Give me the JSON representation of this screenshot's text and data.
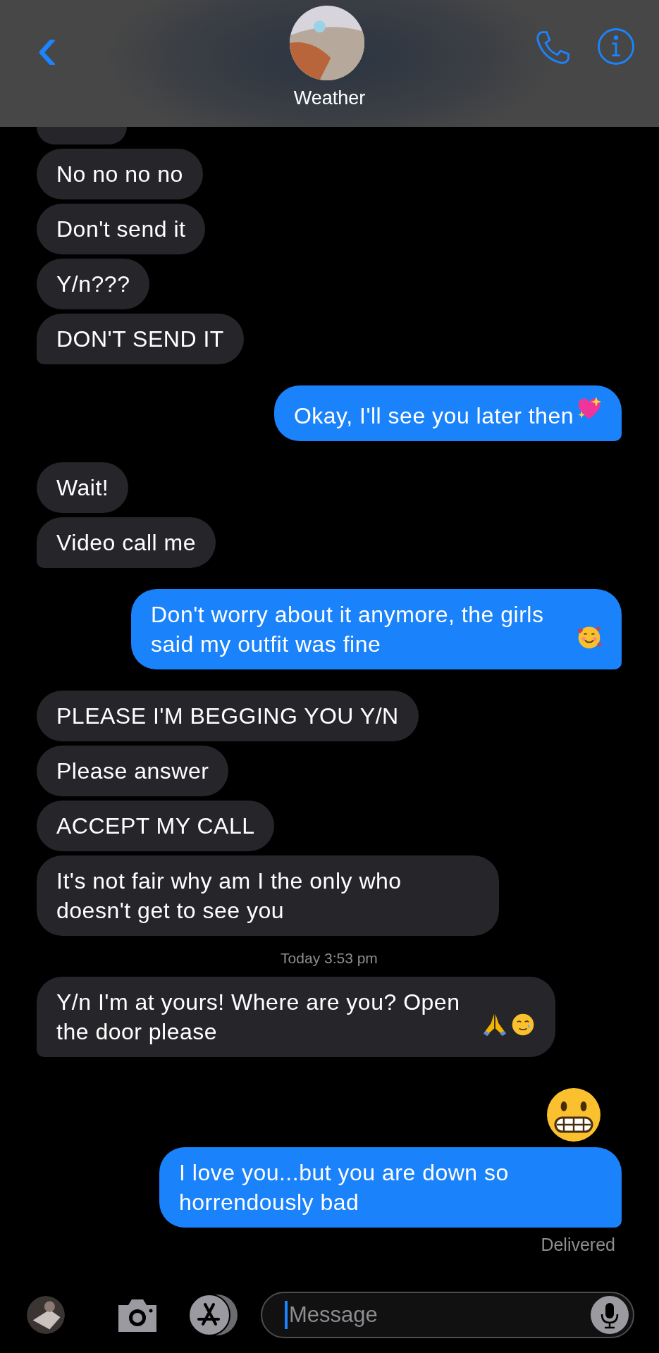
{
  "header": {
    "back": "‹",
    "contact": "Weather"
  },
  "messages": [
    {
      "outgoing": false,
      "kind": "cut"
    },
    {
      "outgoing": false,
      "kind": "text",
      "text": "No no no no"
    },
    {
      "outgoing": false,
      "kind": "text",
      "text": "Don't send it"
    },
    {
      "outgoing": false,
      "kind": "text",
      "text": "Y/n???"
    },
    {
      "outgoing": false,
      "kind": "text",
      "text": "DON'T SEND IT"
    },
    {
      "outgoing": true,
      "kind": "text",
      "text": "Okay, I'll see you later then",
      "emoji": [
        {
          "kind": "sparkling-heart"
        }
      ]
    },
    {
      "outgoing": false,
      "kind": "text",
      "text": "Wait!"
    },
    {
      "outgoing": false,
      "kind": "text",
      "text": "Video call me"
    },
    {
      "outgoing": true,
      "kind": "text",
      "text": "Don't worry about it anymore, the girls said my outfit was fine",
      "emoji": [
        {
          "kind": "hearts-face"
        }
      ]
    },
    {
      "outgoing": false,
      "kind": "text",
      "text": "PLEASE I'M BEGGING YOU Y/N"
    },
    {
      "outgoing": false,
      "kind": "text",
      "text": "Please answer"
    },
    {
      "outgoing": false,
      "kind": "text",
      "text": "ACCEPT MY CALL"
    },
    {
      "outgoing": false,
      "kind": "text",
      "text": "It's not fair why am I the only who doesn't get to see you"
    },
    {
      "kind": "timestamp",
      "text": "Today 3:53 pm"
    },
    {
      "outgoing": false,
      "kind": "text",
      "text": "Y/n I'm at yours! Where are you? Open the door please",
      "emoji": [
        {
          "kind": "folded-hands"
        },
        {
          "kind": "tear-face"
        }
      ]
    },
    {
      "outgoing": true,
      "kind": "emoji",
      "emoji": [
        {
          "kind": "grimace-face"
        }
      ]
    },
    {
      "outgoing": true,
      "kind": "text",
      "text": "I love you...but you are down so horrendously bad"
    }
  ],
  "status": "Delivered",
  "compose": {
    "placeholder": "Message"
  }
}
